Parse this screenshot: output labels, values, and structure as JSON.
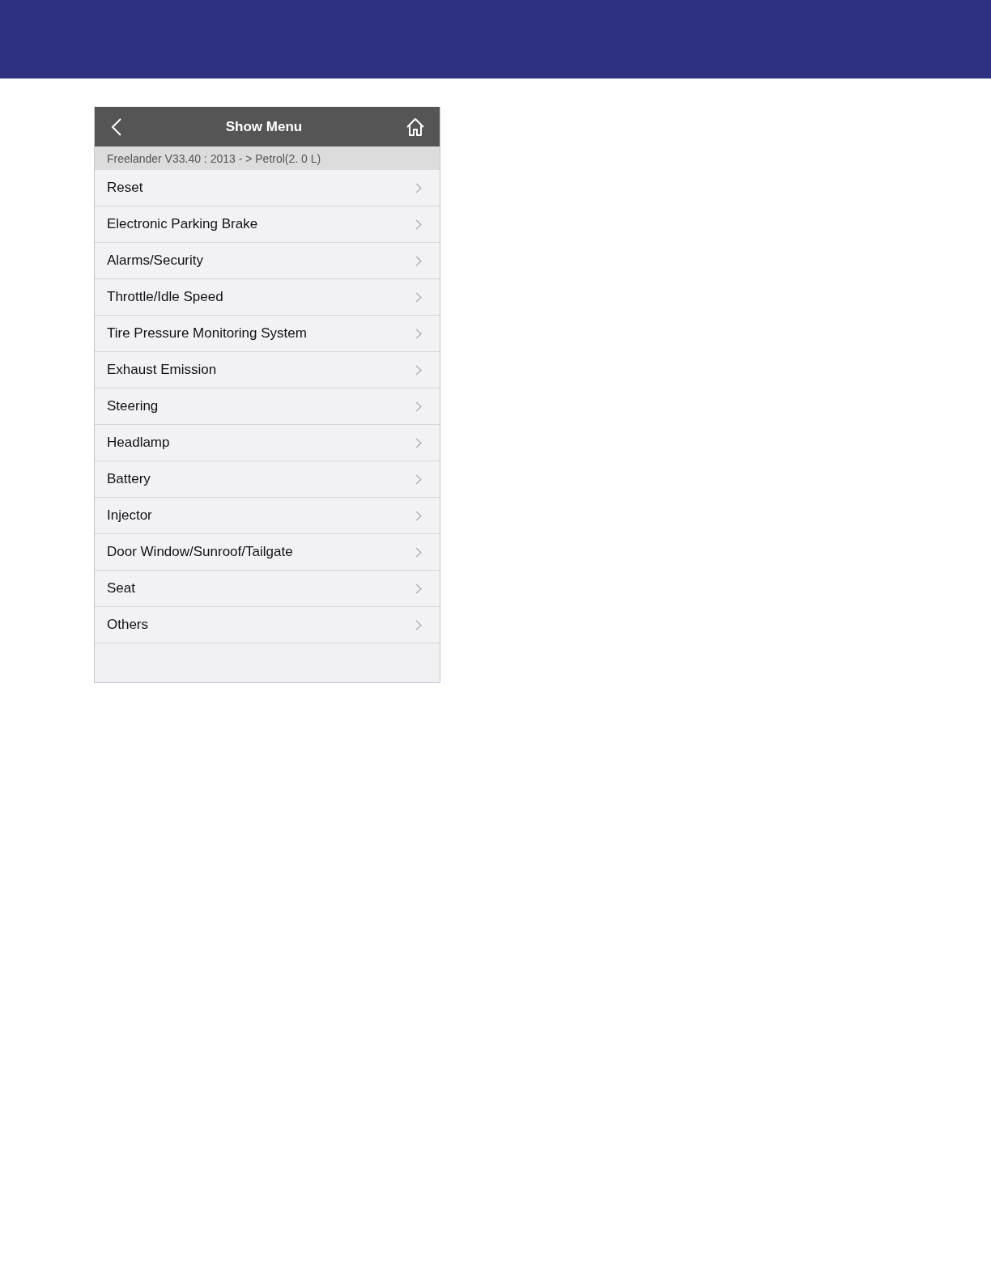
{
  "nav_bar": {
    "title": "Show Menu"
  },
  "breadcrumb": "Freelander V33.40 : 2013 - > Petrol(2. 0 L)",
  "menu_items": [
    {
      "label": "Reset"
    },
    {
      "label": "Electronic Parking Brake"
    },
    {
      "label": "Alarms/Security"
    },
    {
      "label": "Throttle/Idle Speed"
    },
    {
      "label": "Tire Pressure Monitoring System"
    },
    {
      "label": "Exhaust Emission"
    },
    {
      "label": "Steering"
    },
    {
      "label": "Headlamp"
    },
    {
      "label": "Battery"
    },
    {
      "label": "Injector"
    },
    {
      "label": "Door Window/Sunroof/Tailgate"
    },
    {
      "label": "Seat"
    },
    {
      "label": "Others"
    }
  ]
}
